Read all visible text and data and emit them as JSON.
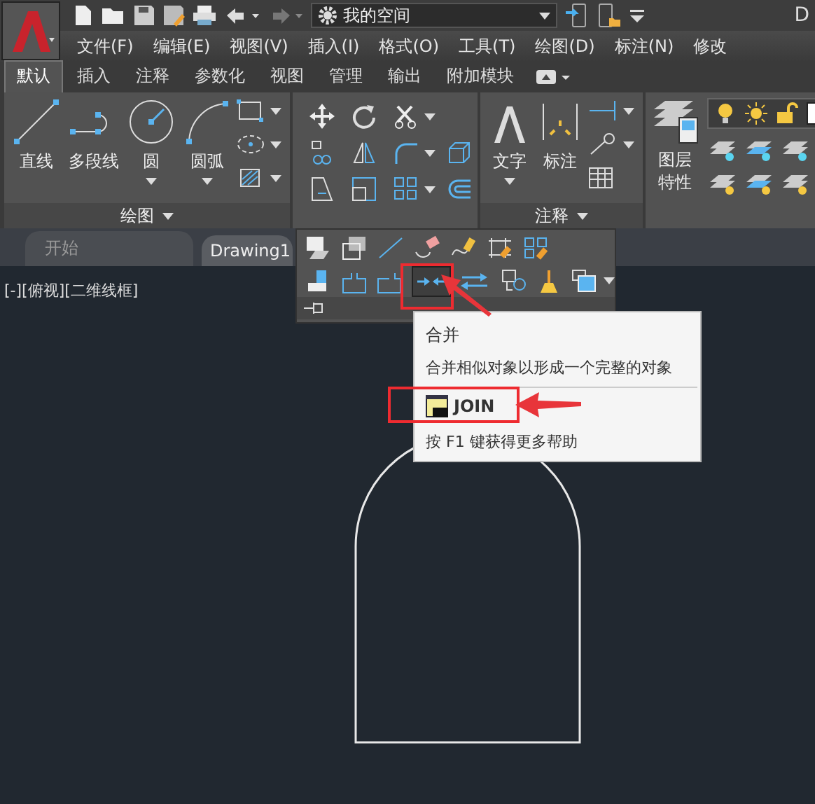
{
  "app": {
    "workspace": "我的空间",
    "title": "D"
  },
  "menu_bar": [
    "文件(F)",
    "编辑(E)",
    "视图(V)",
    "插入(I)",
    "格式(O)",
    "工具(T)",
    "绘图(D)",
    "标注(N)",
    "修改"
  ],
  "ribbon_tabs": [
    {
      "label": "默认",
      "selected": true
    },
    {
      "label": "插入",
      "selected": false
    },
    {
      "label": "注释",
      "selected": false
    },
    {
      "label": "参数化",
      "selected": false
    },
    {
      "label": "视图",
      "selected": false
    },
    {
      "label": "管理",
      "selected": false
    },
    {
      "label": "输出",
      "selected": false
    },
    {
      "label": "附加模块",
      "selected": false
    }
  ],
  "draw_panel": {
    "title": "绘图",
    "tools": [
      {
        "label": "直线",
        "dropdown": false
      },
      {
        "label": "多段线",
        "dropdown": false
      },
      {
        "label": "圆",
        "dropdown": true
      },
      {
        "label": "圆弧",
        "dropdown": true
      }
    ]
  },
  "annotation_panel": {
    "title": "注释",
    "tools": [
      {
        "label": "文字",
        "dropdown": true
      },
      {
        "label": "标注",
        "dropdown": false
      }
    ]
  },
  "layers_panel": {
    "tool": "图层特性"
  },
  "file_tabs": [
    {
      "label": "开始",
      "selected": false
    },
    {
      "label": "Drawing1",
      "selected": true
    }
  ],
  "viewport": {
    "label": "[-][俯视][二维线框]"
  },
  "tooltip": {
    "title": "合并",
    "description": "合并相似对象以形成一个完整的对象",
    "command": "JOIN",
    "help": "按 F1 键获得更多帮助"
  }
}
